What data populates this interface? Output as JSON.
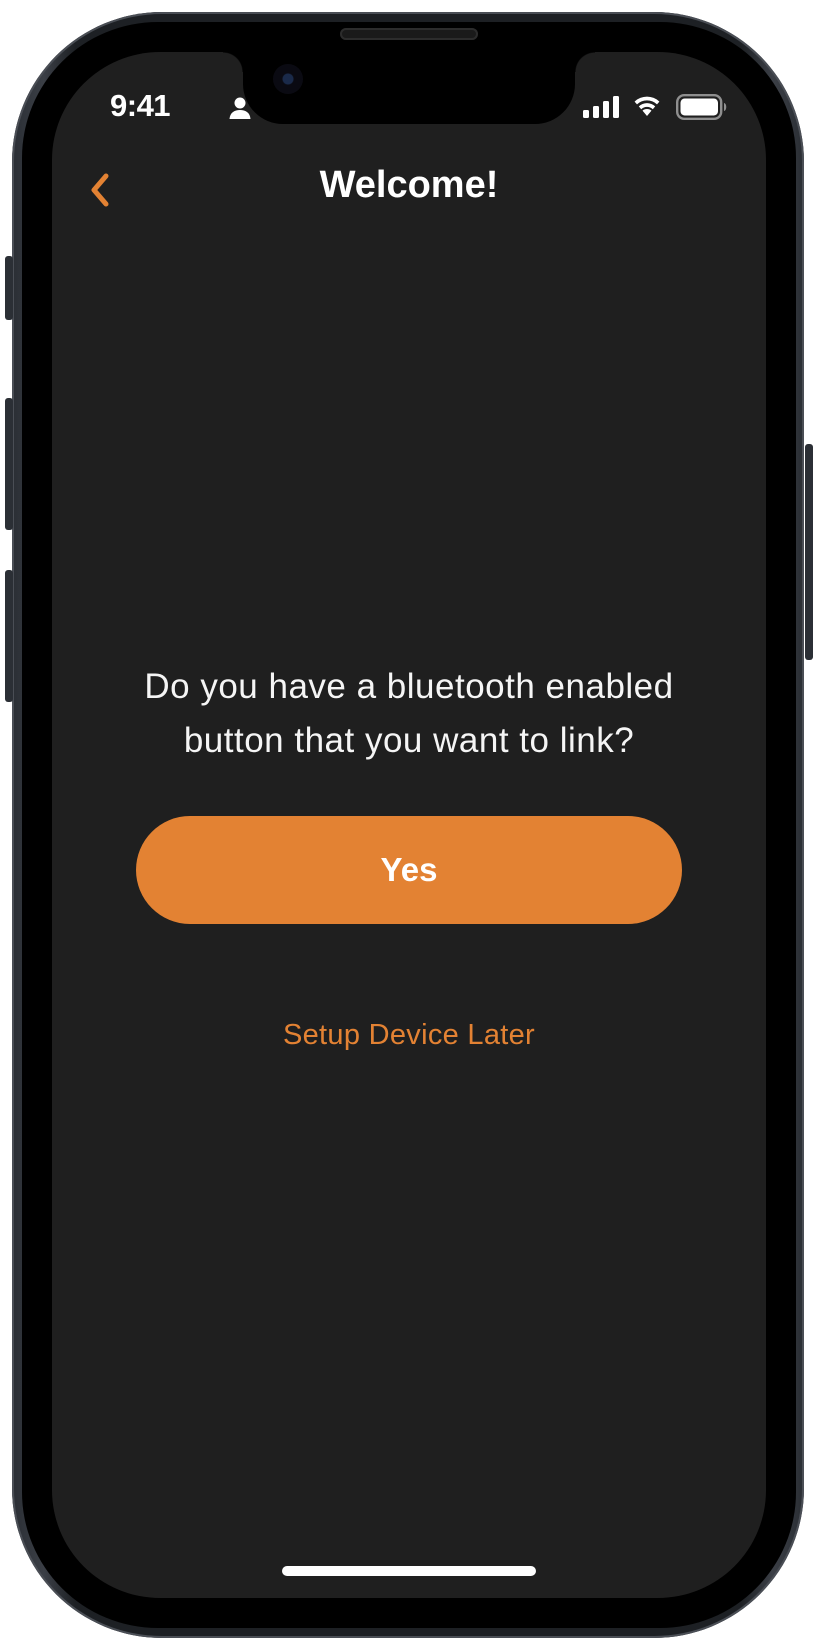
{
  "status_bar": {
    "time": "9:41",
    "person_icon": "person-icon",
    "signal_icon": "cellular-signal-icon",
    "wifi_icon": "wifi-icon",
    "battery_icon": "battery-icon"
  },
  "nav": {
    "back_icon": "chevron-left-icon",
    "title": "Welcome!"
  },
  "content": {
    "question_line1": "Do you have a bluetooth enabled",
    "question_line2": "button that you want to link?",
    "yes_label": "Yes",
    "later_label": "Setup Device Later"
  },
  "colors": {
    "accent": "#e38233",
    "screen_background": "#1f1f1f",
    "text": "#ffffff"
  }
}
